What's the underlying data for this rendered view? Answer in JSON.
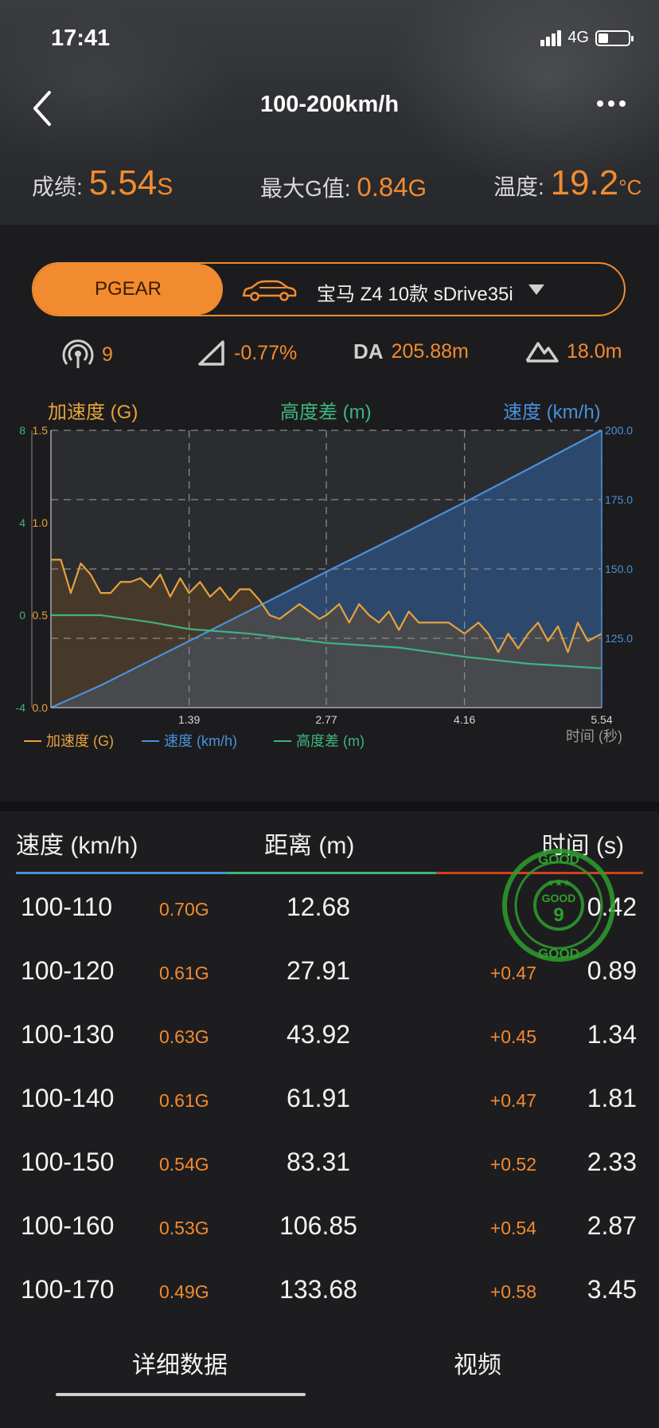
{
  "status_bar": {
    "time": "17:41",
    "network": "4G"
  },
  "header": {
    "title": "100-200km/h",
    "score_label": "成绩:",
    "score_value": "5.54",
    "score_unit": "S",
    "g_label": "最大G值:",
    "g_value": "0.84",
    "g_unit": "G",
    "temp_label": "温度:",
    "temp_value": "19.2",
    "temp_unit": "°C"
  },
  "selector": {
    "device": "PGEAR",
    "car": "宝马 Z4 10款 sDrive35i"
  },
  "metrics": {
    "satellites": "9",
    "slope": "-0.77%",
    "da_label": "DA",
    "da_value": "205.88m",
    "altitude": "18.0m"
  },
  "axis_titles": {
    "left": "加速度 (G)",
    "middle": "高度差 (m)",
    "right": "速度 (km/h)"
  },
  "chart_data": {
    "type": "line",
    "x_label": "时间 (秒)",
    "x_ticks": [
      "1.39",
      "2.77",
      "4.16",
      "5.54"
    ],
    "xlim": [
      0,
      5.54
    ],
    "y_left_accel_ticks": [
      "1.5",
      "1.0",
      "0.5",
      "0.0"
    ],
    "y_left_accel_range": [
      0,
      1.5
    ],
    "y_left_alt_ticks": [
      "8",
      "4",
      "0",
      "-4"
    ],
    "y_left_alt_range": [
      -4,
      8
    ],
    "y_right_ticks": [
      "200.0",
      "175.0",
      "150.0",
      "125.0"
    ],
    "y_right_range": [
      100,
      200
    ],
    "legend": [
      "加速度 (G)",
      "速度 (km/h)",
      "高度差 (m)"
    ],
    "series": [
      {
        "name": "速度 (km/h)",
        "color": "#4a90d9",
        "x": [
          0,
          0.5,
          1.0,
          1.39,
          2.0,
          2.77,
          3.5,
          4.16,
          4.8,
          5.54
        ],
        "values": [
          100,
          108,
          117,
          124,
          135,
          149,
          162,
          174,
          186,
          200
        ]
      },
      {
        "name": "加速度 (G)",
        "color": "#e6a23c",
        "x": [
          0,
          0.1,
          0.2,
          0.3,
          0.4,
          0.5,
          0.6,
          0.7,
          0.8,
          0.9,
          1.0,
          1.1,
          1.2,
          1.3,
          1.39,
          1.5,
          1.6,
          1.7,
          1.8,
          1.9,
          2.0,
          2.1,
          2.2,
          2.3,
          2.4,
          2.5,
          2.6,
          2.7,
          2.77,
          2.9,
          3.0,
          3.1,
          3.2,
          3.3,
          3.4,
          3.5,
          3.6,
          3.7,
          3.8,
          3.9,
          4.0,
          4.16,
          4.3,
          4.4,
          4.5,
          4.6,
          4.7,
          4.8,
          4.9,
          5.0,
          5.1,
          5.2,
          5.3,
          5.4,
          5.54
        ],
        "values": [
          0.8,
          0.8,
          0.62,
          0.78,
          0.72,
          0.62,
          0.62,
          0.68,
          0.68,
          0.7,
          0.65,
          0.72,
          0.6,
          0.7,
          0.62,
          0.68,
          0.6,
          0.65,
          0.58,
          0.64,
          0.64,
          0.58,
          0.5,
          0.48,
          0.52,
          0.56,
          0.52,
          0.48,
          0.5,
          0.56,
          0.46,
          0.56,
          0.5,
          0.46,
          0.52,
          0.42,
          0.52,
          0.46,
          0.46,
          0.46,
          0.46,
          0.4,
          0.46,
          0.4,
          0.3,
          0.4,
          0.32,
          0.4,
          0.46,
          0.36,
          0.44,
          0.3,
          0.46,
          0.36,
          0.4
        ]
      },
      {
        "name": "高度差 (m)",
        "color": "#3fb37f",
        "x": [
          0,
          0.5,
          1.0,
          1.39,
          2.0,
          2.77,
          3.5,
          4.16,
          4.8,
          5.54
        ],
        "values": [
          0,
          0.0,
          -0.3,
          -0.6,
          -0.8,
          -1.2,
          -1.4,
          -1.8,
          -2.1,
          -2.3
        ]
      }
    ]
  },
  "table": {
    "headers": {
      "speed": "速度 (km/h)",
      "distance": "距离 (m)",
      "time": "时间 (s)"
    },
    "rows": [
      {
        "speed": "100-110",
        "g": "0.70G",
        "distance": "12.68",
        "delta": "",
        "time": "0.42"
      },
      {
        "speed": "100-120",
        "g": "0.61G",
        "distance": "27.91",
        "delta": "+0.47",
        "time": "0.89"
      },
      {
        "speed": "100-130",
        "g": "0.63G",
        "distance": "43.92",
        "delta": "+0.45",
        "time": "1.34"
      },
      {
        "speed": "100-140",
        "g": "0.61G",
        "distance": "61.91",
        "delta": "+0.47",
        "time": "1.81"
      },
      {
        "speed": "100-150",
        "g": "0.54G",
        "distance": "83.31",
        "delta": "+0.52",
        "time": "2.33"
      },
      {
        "speed": "100-160",
        "g": "0.53G",
        "distance": "106.85",
        "delta": "+0.54",
        "time": "2.87"
      },
      {
        "speed": "100-170",
        "g": "0.49G",
        "distance": "133.68",
        "delta": "+0.58",
        "time": "3.45"
      }
    ]
  },
  "stamp": {
    "text": "GOOD",
    "number": "9",
    "color": "#2e9e2e"
  },
  "tabs": [
    "详细数据",
    "视频"
  ],
  "colors": {
    "accent": "#f28b30",
    "speed": "#4a90d9",
    "accel": "#e6a23c",
    "alt": "#3fb37f",
    "alt_line": "#d0421f"
  }
}
